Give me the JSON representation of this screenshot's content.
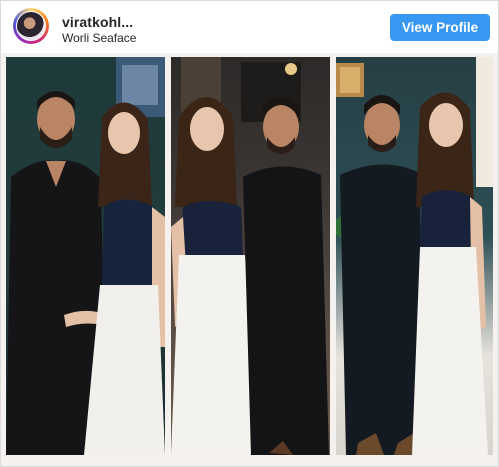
{
  "header": {
    "username": "viratkohl...",
    "location": "Worli Seaface",
    "view_profile_label": "View Profile"
  },
  "post": {
    "panels": [
      "photo-panel-left",
      "photo-panel-center",
      "photo-panel-right"
    ]
  },
  "colors": {
    "button_bg": "#3897f0",
    "border": "#dbdbdb",
    "text": "#262626"
  }
}
